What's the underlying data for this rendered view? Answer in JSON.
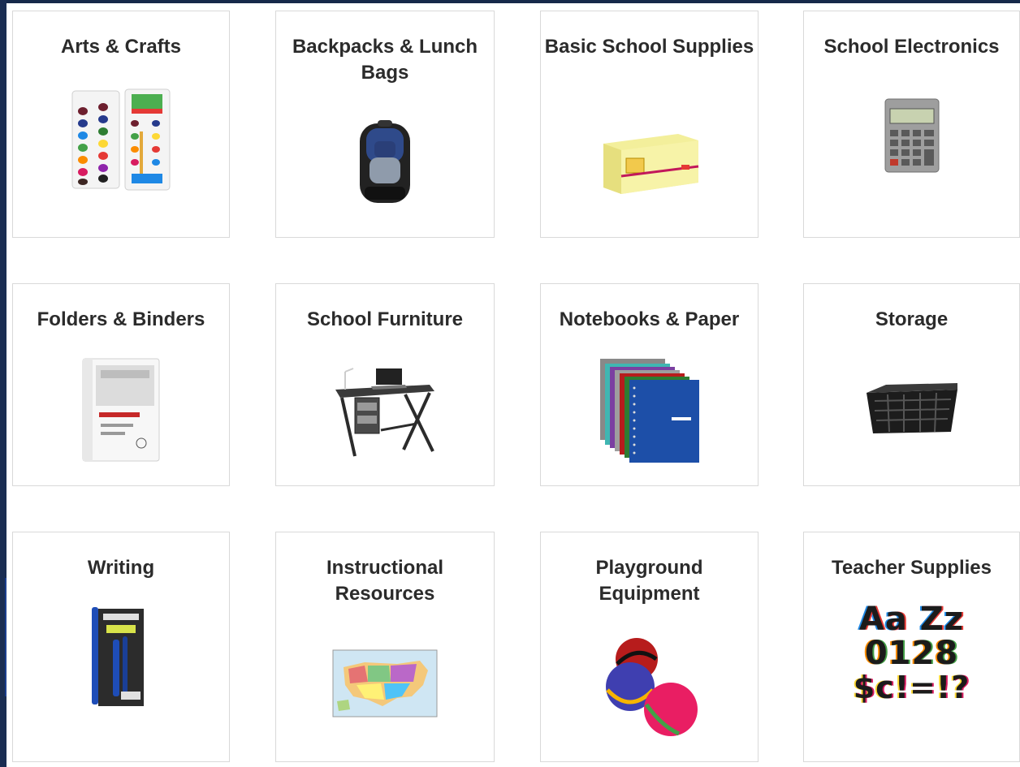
{
  "categories": [
    {
      "label": "Arts & Crafts",
      "icon": "watercolor-paint-icon"
    },
    {
      "label": "Backpacks & Lunch Bags",
      "icon": "backpack-icon"
    },
    {
      "label": "Basic School Supplies",
      "icon": "sticky-notes-icon"
    },
    {
      "label": "School Electronics",
      "icon": "calculator-icon"
    },
    {
      "label": "Folders & Binders",
      "icon": "binder-icon"
    },
    {
      "label": "School Furniture",
      "icon": "desk-icon"
    },
    {
      "label": "Notebooks & Paper",
      "icon": "notebooks-icon"
    },
    {
      "label": "Storage",
      "icon": "storage-basket-icon"
    },
    {
      "label": "Writing",
      "icon": "pen-pack-icon"
    },
    {
      "label": "Instructional Resources",
      "icon": "us-map-icon"
    },
    {
      "label": "Playground Equipment",
      "icon": "balls-icon"
    },
    {
      "label": "Teacher Supplies",
      "icon": "letters-numbers-icon",
      "glyph_lines": [
        "Aa Zz",
        "0128",
        "$c!=!?"
      ]
    }
  ],
  "colors": {
    "page_background": "#16294a",
    "tile_border": "#d9d9d9",
    "title_text": "#2b2b2b"
  }
}
